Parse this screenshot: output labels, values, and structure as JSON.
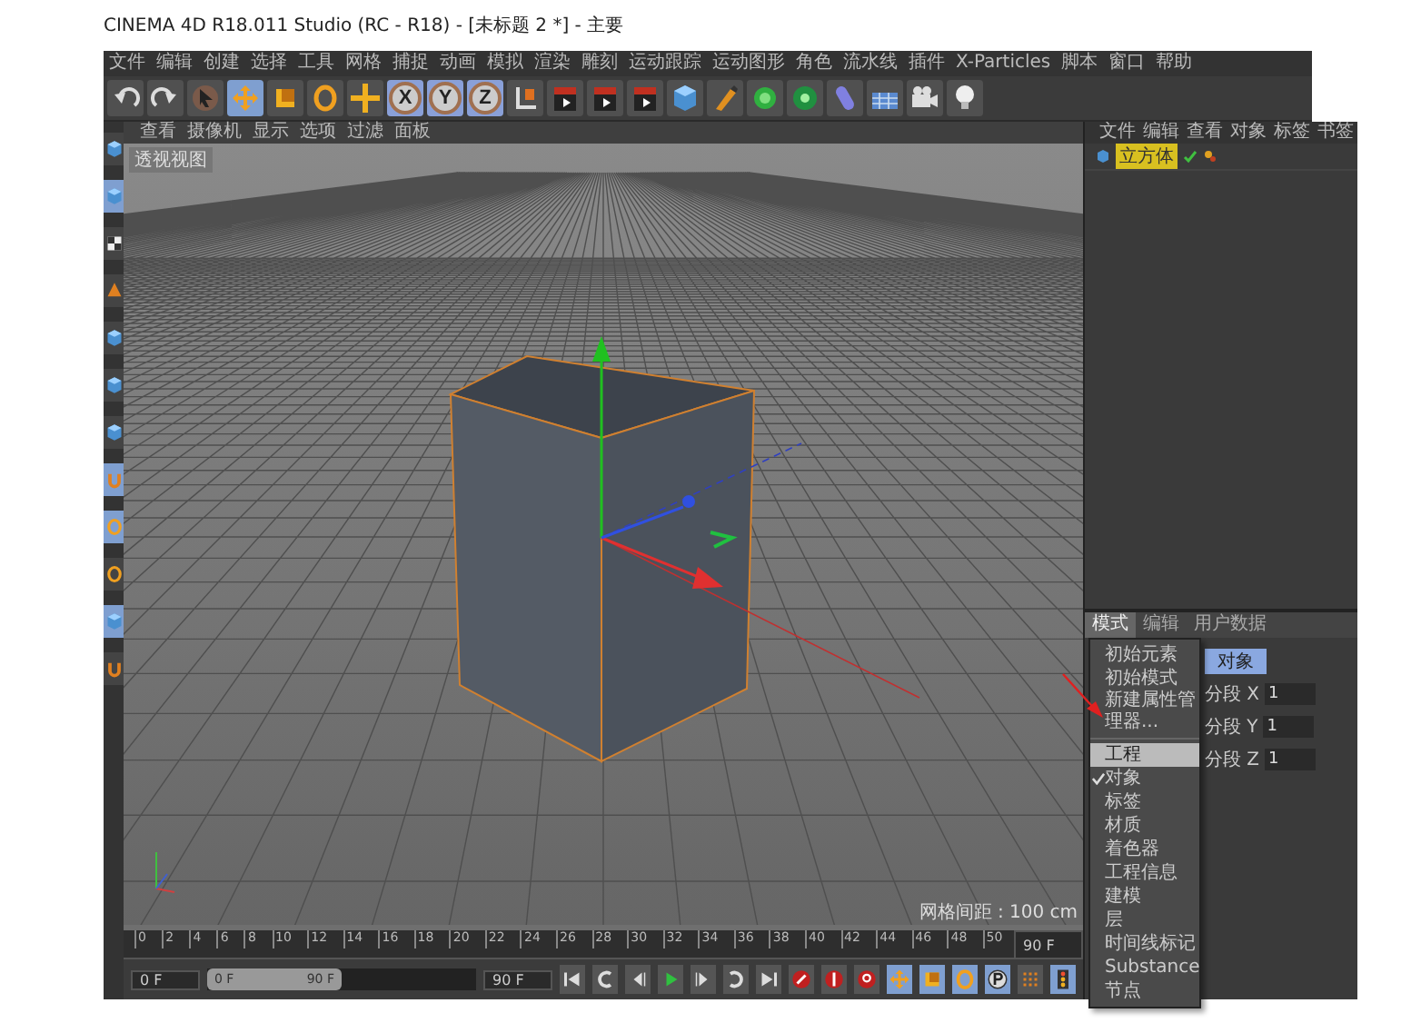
{
  "window": {
    "title": "CINEMA 4D R18.011 Studio (RC - R18) - [未标题 2 *] - 主要"
  },
  "menu_bar": [
    "文件",
    "编辑",
    "创建",
    "选择",
    "工具",
    "网格",
    "捕捉",
    "动画",
    "模拟",
    "渲染",
    "雕刻",
    "运动跟踪",
    "运动图形",
    "角色",
    "流水线",
    "插件",
    "X-Particles",
    "脚本",
    "窗口",
    "帮助"
  ],
  "toolbar": [
    {
      "kind": "undo",
      "selected": false
    },
    {
      "kind": "redo",
      "selected": false
    },
    {
      "kind": "select",
      "selected": false
    },
    {
      "kind": "move",
      "selected": true
    },
    {
      "kind": "scale",
      "selected": false
    },
    {
      "kind": "rotate",
      "selected": false
    },
    {
      "kind": "add",
      "selected": false
    },
    {
      "kind": "axis",
      "label": "X",
      "selected": true
    },
    {
      "kind": "axis",
      "label": "Y",
      "selected": true
    },
    {
      "kind": "axis",
      "label": "Z",
      "selected": true
    },
    {
      "kind": "coord",
      "selected": false
    },
    {
      "kind": "render",
      "selected": false
    },
    {
      "kind": "render",
      "selected": false
    },
    {
      "kind": "render",
      "selected": false
    },
    {
      "kind": "cube",
      "selected": false
    },
    {
      "kind": "pen",
      "selected": false
    },
    {
      "kind": "subdiv",
      "selected": false
    },
    {
      "kind": "array",
      "selected": false
    },
    {
      "kind": "deformer",
      "selected": false
    },
    {
      "kind": "floor",
      "selected": false
    },
    {
      "kind": "camera",
      "selected": false
    },
    {
      "kind": "light",
      "selected": false
    }
  ],
  "left_toolbar": [
    {
      "kind": "cube",
      "selected": false
    },
    {
      "kind": "cube",
      "selected": true
    },
    {
      "kind": "checker",
      "selected": false
    },
    {
      "kind": "cone",
      "selected": false
    },
    {
      "kind": "cube",
      "selected": false
    },
    {
      "kind": "cube",
      "selected": false
    },
    {
      "kind": "cube",
      "selected": false
    },
    {
      "kind": "magnet",
      "selected": true
    },
    {
      "kind": "rotate",
      "selected": true
    },
    {
      "kind": "rotate",
      "selected": false
    },
    {
      "kind": "cube",
      "selected": true
    },
    {
      "kind": "magnet",
      "selected": false
    }
  ],
  "viewport": {
    "menu": [
      "查看",
      "摄像机",
      "显示",
      "选项",
      "过滤",
      "面板"
    ],
    "label": "透视视图",
    "grid_spacing": "网格间距 : 100 cm"
  },
  "timeline": {
    "ticks": [
      "0",
      "2",
      "4",
      "6",
      "8",
      "10",
      "12",
      "14",
      "16",
      "18",
      "20",
      "22",
      "24",
      "26",
      "28",
      "30",
      "32",
      "34",
      "36",
      "38",
      "40",
      "42",
      "44",
      "46",
      "48",
      "50"
    ],
    "end_field": "90 F",
    "current": "0 F",
    "range": {
      "start": "0 F",
      "end": "90 F",
      "level": 0.5
    },
    "max_field": "90 F",
    "transport": [
      {
        "kind": "first",
        "selected": false
      },
      {
        "kind": "prev-key",
        "selected": false
      },
      {
        "kind": "prev-frame",
        "selected": false
      },
      {
        "kind": "play",
        "selected": false
      },
      {
        "kind": "next-frame",
        "selected": false
      },
      {
        "kind": "next-key",
        "selected": false
      },
      {
        "kind": "last",
        "selected": false
      },
      {
        "kind": "record",
        "selected": false
      },
      {
        "kind": "autokey",
        "selected": false
      },
      {
        "kind": "keyhelp",
        "selected": false
      },
      {
        "kind": "move",
        "selected": true
      },
      {
        "kind": "scale",
        "selected": true
      },
      {
        "kind": "rotate",
        "selected": true
      },
      {
        "kind": "param",
        "selected": true
      },
      {
        "kind": "dots",
        "selected": false
      },
      {
        "kind": "timeline",
        "selected": true
      }
    ]
  },
  "object_manager": {
    "menu": [
      "文件",
      "编辑",
      "查看",
      "对象",
      "标签",
      "书签"
    ],
    "objects": [
      {
        "name": "立方体",
        "selected": true
      }
    ]
  },
  "attribute_manager": {
    "tabs": [
      {
        "label": "模式",
        "selected": true
      },
      {
        "label": "编辑",
        "selected": false
      },
      {
        "label": "用户数据",
        "selected": false
      }
    ],
    "mode_buttons": [
      {
        "label": "对象",
        "selected": true
      }
    ],
    "fields": [
      {
        "label": "分段 X",
        "value": "1"
      },
      {
        "label": "分段 Y",
        "value": "1"
      },
      {
        "label": "分段 Z",
        "value": "1"
      }
    ],
    "mode_menu": [
      {
        "label": "初始元素",
        "checked": false,
        "selected": false
      },
      {
        "label": "初始模式",
        "checked": false,
        "selected": false
      },
      {
        "label": "新建属性管理器...",
        "checked": false,
        "selected": false
      },
      {
        "kind": "separator"
      },
      {
        "label": "工程",
        "checked": false,
        "selected": true
      },
      {
        "label": "对象",
        "checked": true,
        "selected": false
      },
      {
        "label": "标签",
        "checked": false,
        "selected": false
      },
      {
        "label": "材质",
        "checked": false,
        "selected": false
      },
      {
        "label": "着色器",
        "checked": false,
        "selected": false
      },
      {
        "label": "工程信息",
        "checked": false,
        "selected": false
      },
      {
        "label": "建模",
        "checked": false,
        "selected": false
      },
      {
        "label": "层",
        "checked": false,
        "selected": false
      },
      {
        "label": "时间线标记",
        "checked": false,
        "selected": false
      },
      {
        "label": "Substance",
        "checked": false,
        "selected": false
      },
      {
        "label": "节点",
        "checked": false,
        "selected": false
      }
    ]
  }
}
